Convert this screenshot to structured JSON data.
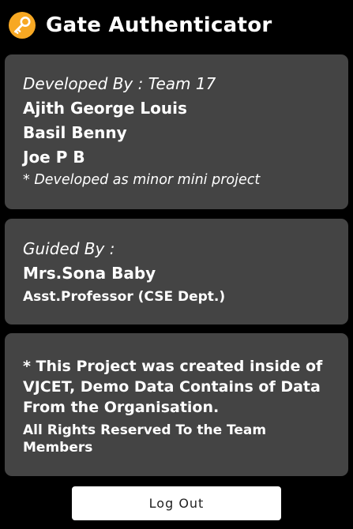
{
  "app": {
    "title": "Gate Authenticator",
    "icon": "key-icon",
    "accent_color": "#f7a823"
  },
  "developers_card": {
    "heading": "Developed By : Team 17",
    "members": [
      "Ajith George Louis",
      "Basil Benny",
      "Joe P B"
    ],
    "note": "* Developed as minor mini project"
  },
  "guide_card": {
    "heading": "Guided By :",
    "name": "Mrs.Sona Baby",
    "designation": "Asst.Professor (CSE Dept.)"
  },
  "info_card": {
    "statement": "* This Project was created inside of VJCET, Demo Data Contains of Data From the Organisation.",
    "rights": "All Rights Reserved To the Team Members"
  },
  "actions": {
    "logout_label": "Log Out"
  }
}
